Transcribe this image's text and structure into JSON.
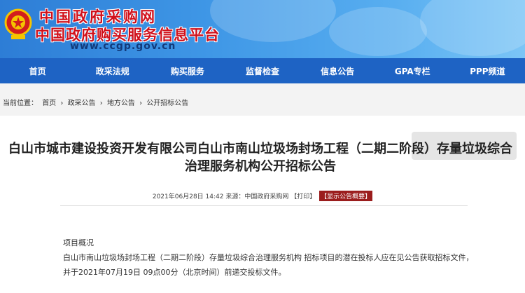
{
  "header": {
    "site_name": "中国政府采购网",
    "site_subtitle": "中国政府购买服务信息平台",
    "url": "www.ccgp.gov.cn"
  },
  "nav": [
    {
      "label": "首页"
    },
    {
      "label": "政采法规"
    },
    {
      "label": "购买服务"
    },
    {
      "label": "监督检查"
    },
    {
      "label": "信息公告"
    },
    {
      "label": "GPA专栏"
    },
    {
      "label": "PPP频道"
    }
  ],
  "breadcrumb": {
    "prefix": "当前位置：",
    "items": [
      "首页",
      "政采公告",
      "地方公告",
      "公开招标公告"
    ],
    "separator": "›"
  },
  "article": {
    "title": "白山市城市建设投资开发有限公司白山市南山垃圾场封场工程（二期二阶段）存量垃圾综合治理服务机构公开招标公告",
    "date": "2021年06月28日 14:42",
    "source": "来源：中国政府采购网",
    "print": "【打印】",
    "summary_button": "【显示公告概要】",
    "section_title": "项目概况",
    "paragraph": "白山市南山垃圾场封场工程（二期二阶段）存量垃圾综合治理服务机构 招标项目的潜在投标人应在见公告获取招标文件，并于2021年07月19日 09点00分（北京时间）前递交投标文件。"
  },
  "colors": {
    "nav_bg": "#1e63c4",
    "brand_red": "#d0101b",
    "badge_bg": "#9b1d1d"
  }
}
